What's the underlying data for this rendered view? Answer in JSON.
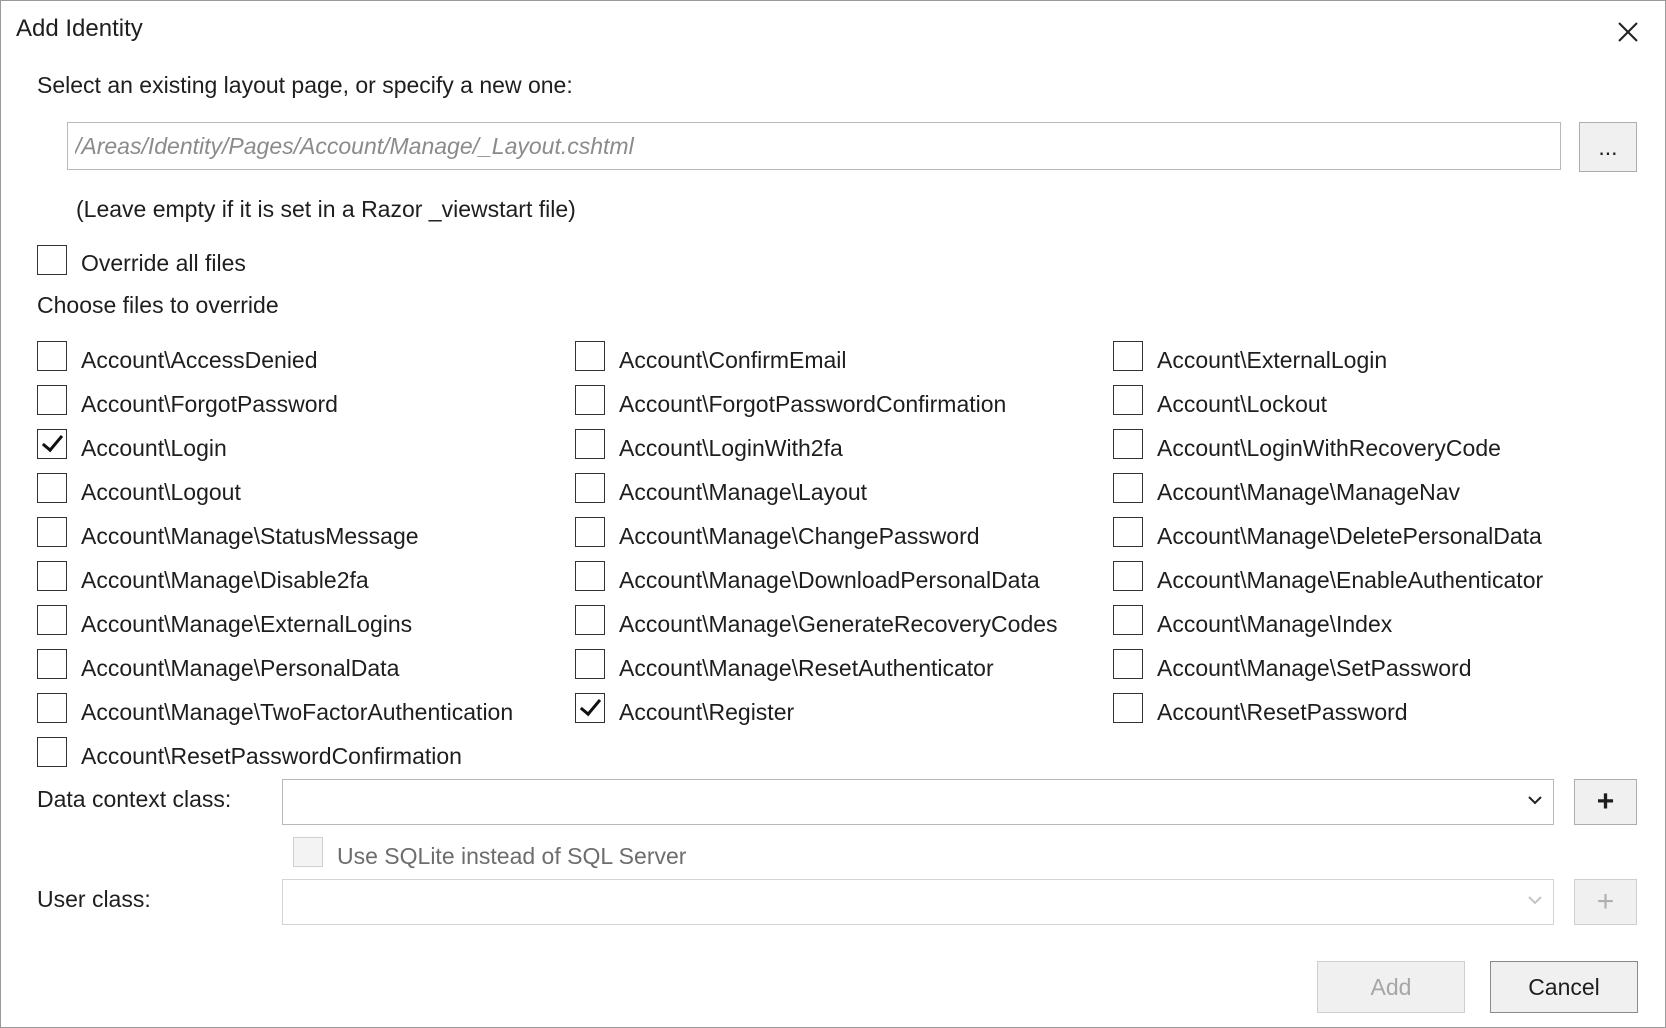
{
  "dialog": {
    "title": "Add Identity"
  },
  "layout": {
    "label": "Select an existing layout page, or specify a new one:",
    "placeholder": "/Areas/Identity/Pages/Account/Manage/_Layout.cshtml",
    "value": "",
    "browse_label": "...",
    "hint": "(Leave empty if it is set in a Razor _viewstart file)"
  },
  "override_all": {
    "label": "Override all files",
    "checked": false
  },
  "choose_label": "Choose files to override",
  "files": [
    {
      "label": "Account\\AccessDenied",
      "checked": false
    },
    {
      "label": "Account\\ConfirmEmail",
      "checked": false
    },
    {
      "label": "Account\\ExternalLogin",
      "checked": false
    },
    {
      "label": "Account\\ForgotPassword",
      "checked": false
    },
    {
      "label": "Account\\ForgotPasswordConfirmation",
      "checked": false
    },
    {
      "label": "Account\\Lockout",
      "checked": false
    },
    {
      "label": "Account\\Login",
      "checked": true
    },
    {
      "label": "Account\\LoginWith2fa",
      "checked": false
    },
    {
      "label": "Account\\LoginWithRecoveryCode",
      "checked": false
    },
    {
      "label": "Account\\Logout",
      "checked": false
    },
    {
      "label": "Account\\Manage\\Layout",
      "checked": false
    },
    {
      "label": "Account\\Manage\\ManageNav",
      "checked": false
    },
    {
      "label": "Account\\Manage\\StatusMessage",
      "checked": false
    },
    {
      "label": "Account\\Manage\\ChangePassword",
      "checked": false
    },
    {
      "label": "Account\\Manage\\DeletePersonalData",
      "checked": false
    },
    {
      "label": "Account\\Manage\\Disable2fa",
      "checked": false
    },
    {
      "label": "Account\\Manage\\DownloadPersonalData",
      "checked": false
    },
    {
      "label": "Account\\Manage\\EnableAuthenticator",
      "checked": false
    },
    {
      "label": "Account\\Manage\\ExternalLogins",
      "checked": false
    },
    {
      "label": "Account\\Manage\\GenerateRecoveryCodes",
      "checked": false
    },
    {
      "label": "Account\\Manage\\Index",
      "checked": false
    },
    {
      "label": "Account\\Manage\\PersonalData",
      "checked": false
    },
    {
      "label": "Account\\Manage\\ResetAuthenticator",
      "checked": false
    },
    {
      "label": "Account\\Manage\\SetPassword",
      "checked": false
    },
    {
      "label": "Account\\Manage\\TwoFactorAuthentication",
      "checked": false
    },
    {
      "label": "Account\\Register",
      "checked": true
    },
    {
      "label": "Account\\ResetPassword",
      "checked": false
    },
    {
      "label": "Account\\ResetPasswordConfirmation",
      "checked": false
    }
  ],
  "data_context": {
    "label": "Data context class:",
    "value": "",
    "add_label": "+"
  },
  "sqlite": {
    "label": "Use SQLite instead of SQL Server",
    "checked": false,
    "enabled": false
  },
  "user_class": {
    "label": "User class:",
    "value": "",
    "add_label": "+",
    "enabled": false
  },
  "footer": {
    "add_label": "Add",
    "add_enabled": false,
    "cancel_label": "Cancel"
  }
}
